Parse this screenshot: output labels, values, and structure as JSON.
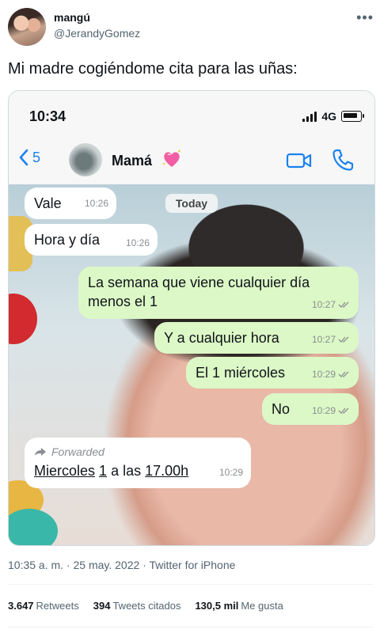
{
  "tweet": {
    "author_name": "mangú",
    "author_handle": "@JerandyGomez",
    "text": "Mi madre cogiéndome cita para las uñas:",
    "more_icon": "more-options-icon",
    "timestamp": "10:35 a. m. · 25 may. 2022 · Twitter for iPhone",
    "stats": {
      "retweets_count": "3.647",
      "retweets_label": "Retweets",
      "quotes_count": "394",
      "quotes_label": "Tweets citados",
      "likes_count": "130,5 mil",
      "likes_label": "Me gusta"
    }
  },
  "phone": {
    "status_time": "10:34",
    "network": "4G",
    "nav": {
      "back_count": "5",
      "contact_name": "Mamá",
      "contact_emoji": "sparkling-heart",
      "accent_color": "#1a82f0"
    },
    "chat": {
      "date_chip": "Today",
      "messages": [
        {
          "dir": "in",
          "text": "Vale",
          "time": "10:26"
        },
        {
          "dir": "in",
          "text": "Hora y día",
          "time": "10:26"
        },
        {
          "dir": "out",
          "text": "La semana que viene cualquier día menos el 1",
          "time": "10:27"
        },
        {
          "dir": "out",
          "text": "Y a cualquier hora",
          "time": "10:27"
        },
        {
          "dir": "out",
          "text": "El 1 miércoles",
          "time": "10:29"
        },
        {
          "dir": "out",
          "text": "No",
          "time": "10:29"
        },
        {
          "dir": "in",
          "forwarded_label": "Forwarded",
          "text_parts": [
            "Miercoles",
            "1",
            "a las",
            "17.00h"
          ],
          "time": "10:29"
        }
      ],
      "outgoing_color": "#dcf8c6",
      "incoming_color": "#ffffff"
    }
  }
}
